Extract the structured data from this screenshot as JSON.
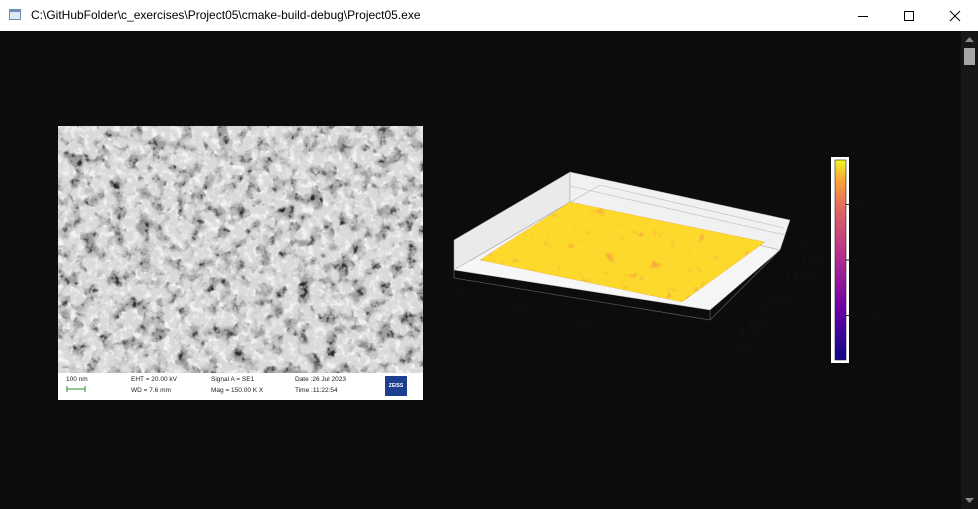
{
  "window": {
    "title": "C:\\GitHubFolder\\c_exercises\\Project05\\cmake-build-debug\\Project05.exe",
    "controls": {
      "minimize": "minimize-icon",
      "maximize": "maximize-icon",
      "close": "close-icon"
    }
  },
  "sem_image": {
    "scale_label": "100 nm",
    "eht": "EHT = 20.00 kV",
    "wd": "WD = 7.6 mm",
    "signal": "Signal A = SE1",
    "mag": "Mag = 150.00 K X",
    "date": "Date :26 Jul 2023",
    "time": "Time :11:22:54",
    "brand": "ZEISS"
  },
  "surface_plot": {
    "chart_data": {
      "type": "surface",
      "x_ticks": [
        "0",
        "500",
        "1000",
        "1500",
        "2000"
      ],
      "y_ticks": [
        "0",
        "200",
        "400",
        "600",
        "800",
        "1000",
        "1200",
        "1400"
      ],
      "z_ticks": [
        "-100",
        "0",
        "100"
      ],
      "colorbar_ticks": [
        "50",
        "0",
        "−50"
      ],
      "colormap": "plasma",
      "colorbar_range": [
        -90,
        90
      ]
    }
  },
  "colors": {
    "background": "#0c0c0c",
    "titlebar": "#ffffff"
  }
}
